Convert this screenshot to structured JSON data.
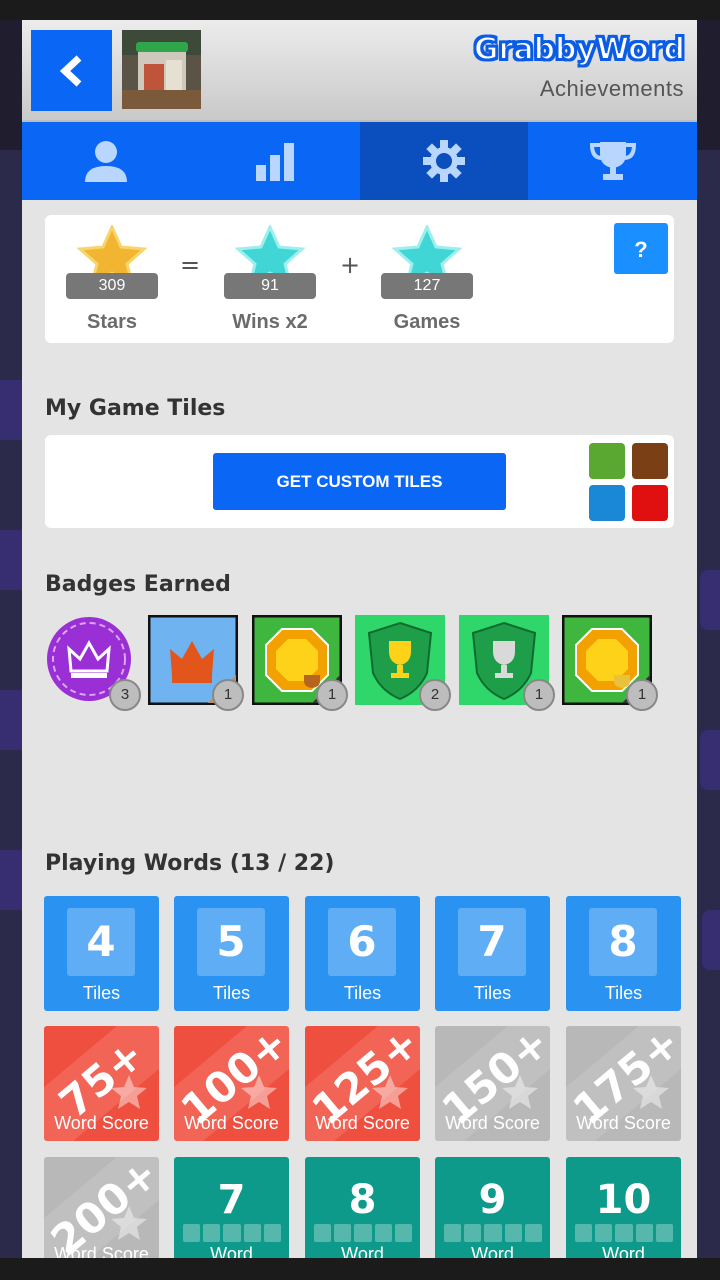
{
  "app": {
    "logo": "GrabbyWord",
    "subtitle": "Achievements"
  },
  "tabs": [
    {
      "name": "profile",
      "icon": "user-icon"
    },
    {
      "name": "stats",
      "icon": "bar-chart-icon"
    },
    {
      "name": "settings",
      "icon": "gear-icon",
      "active": true
    },
    {
      "name": "trophies",
      "icon": "trophy-icon"
    }
  ],
  "stars": {
    "stars_value": "309",
    "stars_label": "Stars",
    "wins_value": "91",
    "wins_label": "Wins x2",
    "games_value": "127",
    "games_label": "Games",
    "equals": "=",
    "plus": "+",
    "help": "?"
  },
  "game_tiles": {
    "title": "My Game Tiles",
    "button": "GET CUSTOM TILES",
    "swatches": [
      "#5aa832",
      "#7a3f14",
      "#1a88d6",
      "#e01010"
    ]
  },
  "badges": {
    "title": "Badges Earned",
    "items": [
      {
        "name": "crown-purple",
        "count": "3"
      },
      {
        "name": "crown-blue",
        "count": "1"
      },
      {
        "name": "gem-bronze",
        "count": "1"
      },
      {
        "name": "shield-1",
        "count": "2"
      },
      {
        "name": "shield-2",
        "count": "1"
      },
      {
        "name": "gem-gold",
        "count": "1"
      }
    ]
  },
  "words": {
    "title": "Playing Words (13 / 22)",
    "tiles_row": [
      {
        "num": "4",
        "label": "Tiles"
      },
      {
        "num": "5",
        "label": "Tiles"
      },
      {
        "num": "6",
        "label": "Tiles"
      },
      {
        "num": "7",
        "label": "Tiles"
      },
      {
        "num": "8",
        "label": "Tiles"
      }
    ],
    "score_row": [
      {
        "num": "75+",
        "label": "Word Score",
        "state": "earned"
      },
      {
        "num": "100+",
        "label": "Word Score",
        "state": "earned"
      },
      {
        "num": "125+",
        "label": "Word Score",
        "state": "earned"
      },
      {
        "num": "150+",
        "label": "Word Score",
        "state": "locked"
      },
      {
        "num": "175+",
        "label": "Word Score",
        "state": "locked"
      }
    ],
    "bottom_row": [
      {
        "num": "200+",
        "label": "Word Score",
        "state": "locked"
      },
      {
        "num": "7",
        "label": "Word"
      },
      {
        "num": "8",
        "label": "Word"
      },
      {
        "num": "9",
        "label": "Word"
      },
      {
        "num": "10",
        "label": "Word"
      }
    ]
  },
  "colors": {
    "primary": "#0a66f5",
    "active_tab": "#0a4fbd",
    "earned_red": "#ef4f3f",
    "locked_gray": "#b8b8b8",
    "teal": "#0e9a8a",
    "tile_blue": "#2a93f2"
  }
}
